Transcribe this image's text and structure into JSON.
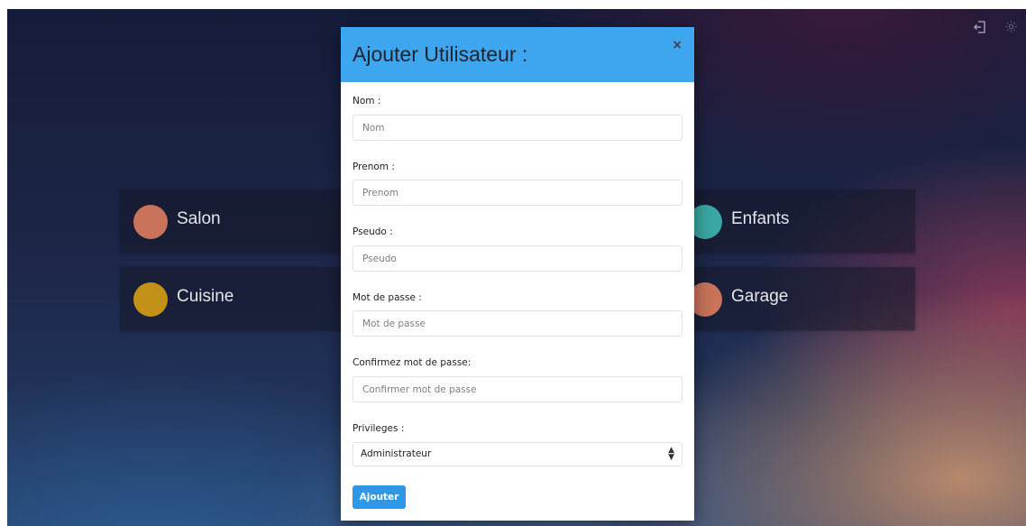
{
  "header_icons": {
    "logout_icon": "logout-icon",
    "settings_icon": "gear-icon"
  },
  "rooms": [
    {
      "label": "Salon",
      "color": "#c8735a"
    },
    {
      "label": "Cuisine",
      "color": "#c49118"
    },
    {
      "label": "Enfants",
      "color": "#3aa7a2"
    },
    {
      "label": "Garage",
      "color": "#c8735a"
    }
  ],
  "modal": {
    "title": "Ajouter Utilisateur :",
    "close_label": "×",
    "fields": [
      {
        "label": "Nom :",
        "placeholder": "Nom",
        "value": ""
      },
      {
        "label": "Prenom :",
        "placeholder": "Prenom",
        "value": ""
      },
      {
        "label": "Pseudo :",
        "placeholder": "Pseudo",
        "value": ""
      },
      {
        "label": "Mot de passe :",
        "placeholder": "Mot de passe",
        "value": ""
      },
      {
        "label": "Confirmez mot de passe:",
        "placeholder": "Confirmer mot de passe",
        "value": ""
      }
    ],
    "privileges": {
      "label": "Privileges :",
      "selected": "Administrateur"
    },
    "submit_label": "Ajouter"
  },
  "colors": {
    "header_blue": "#3ea6ee",
    "button_blue": "#2e98e6"
  }
}
